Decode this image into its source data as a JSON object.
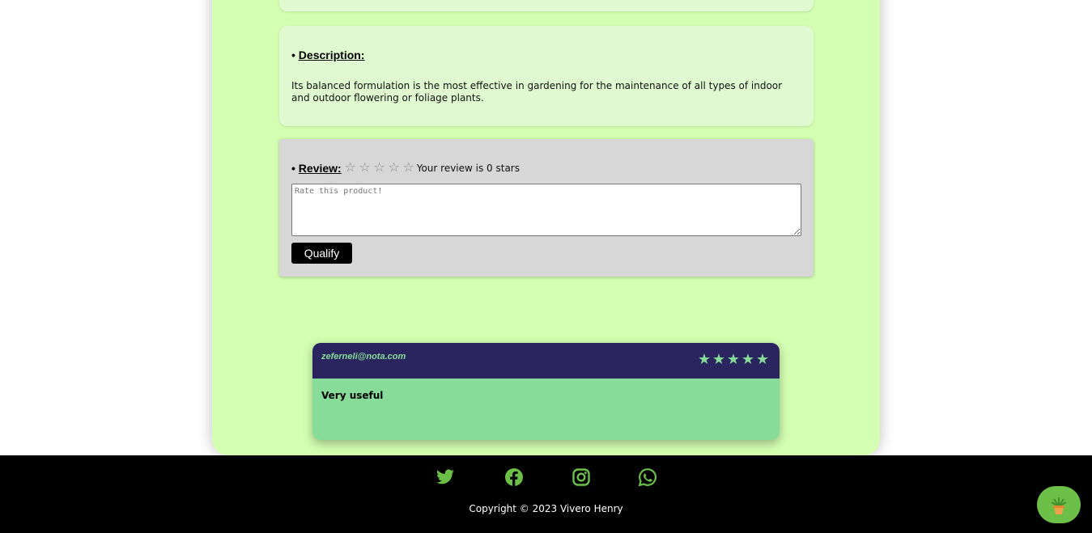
{
  "description": {
    "bullet": "•",
    "heading": "Description:",
    "text": "Its balanced formulation is the most effective in gardening for the maintenance of all types of indoor and outdoor flowering or foliage plants."
  },
  "review": {
    "bullet": "•",
    "heading": "Review:",
    "empty_star": "☆",
    "status": "Your review is 0 stars",
    "placeholder": "Rate this product!",
    "button_label": "Qualify"
  },
  "comment": {
    "email": "zeferneli@nota.com",
    "rating": 5,
    "star": "★",
    "text": "Very useful"
  },
  "footer": {
    "social": [
      "twitter-icon",
      "facebook-icon",
      "instagram-icon",
      "whatsapp-icon"
    ],
    "copyright": "Copyright © 2023 Vivero Henry"
  },
  "colors": {
    "panel_bg": "#d4ffb2",
    "card_bg": "#e1f9d1",
    "review_bg": "#d7d7d7",
    "comment_header": "#2a255f",
    "comment_accent": "#86dc98",
    "social_icon": "#6cbf47",
    "footer_bg": "#000000"
  }
}
